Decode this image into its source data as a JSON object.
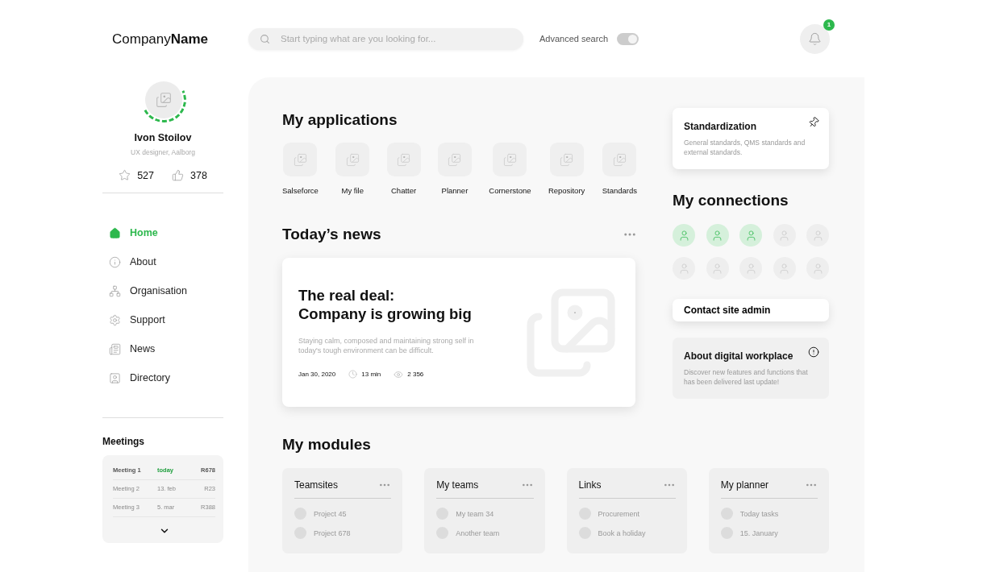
{
  "logo": {
    "regular": "Company",
    "bold": "Name"
  },
  "search": {
    "placeholder": "Start typing what are you looking for..."
  },
  "advanced_search": {
    "label": "Advanced search",
    "on": true
  },
  "notifications": {
    "count": "1"
  },
  "profile": {
    "name": "Ivon Stoilov",
    "role": "UX designer, Aalborg",
    "stars": "527",
    "likes": "378"
  },
  "nav": [
    {
      "label": "Home",
      "selected": true
    },
    {
      "label": "About",
      "selected": false
    },
    {
      "label": "Organisation",
      "selected": false
    },
    {
      "label": "Support",
      "selected": false
    },
    {
      "label": "News",
      "selected": false
    },
    {
      "label": "Directory",
      "selected": false
    }
  ],
  "meetings": {
    "title": "Meetings",
    "rows": [
      {
        "name": "Meeting 1",
        "date": "today",
        "room": "R678",
        "highlighted": true
      },
      {
        "name": "Meeting 2",
        "date": "13. feb",
        "room": "R23",
        "highlighted": false
      },
      {
        "name": "Meeting 3",
        "date": "5. mar",
        "room": "R388",
        "highlighted": false
      }
    ]
  },
  "applications": {
    "title": "My applications",
    "items": [
      "Salseforce",
      "My file",
      "Chatter",
      "Planner",
      "Cornerstone",
      "Repository",
      "Standards"
    ]
  },
  "news": {
    "title": "Today’s news",
    "headline_1": "The real deal:",
    "headline_2": "Company is growing big",
    "summary": "Staying calm, composed and maintaining strong self in today's tough environment can be difficult.",
    "date": "Jan 30, 2020",
    "read_time": "13 min",
    "views": "2 356"
  },
  "standardization": {
    "title": "Standardization",
    "text": "General standards, QMS standards and external standards."
  },
  "connections": {
    "title": "My connections",
    "people": [
      {
        "online": true
      },
      {
        "online": true
      },
      {
        "online": true
      },
      {
        "online": false
      },
      {
        "online": false
      },
      {
        "online": false
      },
      {
        "online": false
      },
      {
        "online": false
      },
      {
        "online": false
      },
      {
        "online": false
      }
    ]
  },
  "contact": {
    "label": "Contact site admin"
  },
  "about": {
    "title": "About digital workplace",
    "text": "Discover new features and functions that has been delivered last update!"
  },
  "modules": {
    "title": "My modules",
    "cards": [
      {
        "title": "Teamsites",
        "items": [
          "Project 45",
          "Project 678"
        ]
      },
      {
        "title": "My teams",
        "items": [
          "My team 34",
          "Another team"
        ]
      },
      {
        "title": "Links",
        "items": [
          "Procurement",
          "Book a holiday"
        ]
      },
      {
        "title": "My planner",
        "items": [
          "Today tasks",
          "15. January"
        ]
      }
    ]
  }
}
